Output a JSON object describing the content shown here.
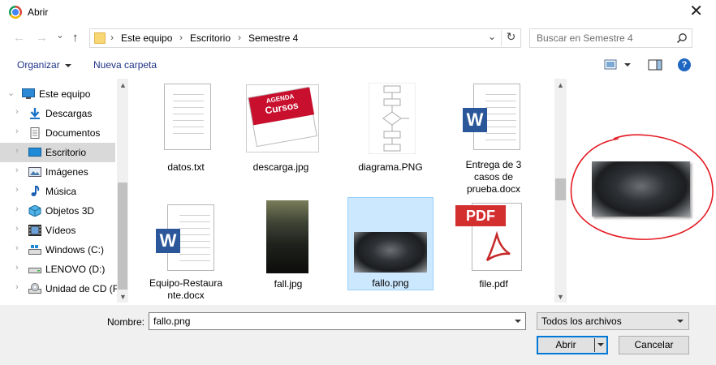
{
  "window": {
    "title": "Abrir",
    "close_glyph": "✕"
  },
  "nav": {
    "back_glyph": "←",
    "forward_glyph": "→",
    "recent_glyph": "⌄",
    "up_glyph": "↑"
  },
  "address": {
    "crumbs": [
      "Este equipo",
      "Escritorio",
      "Semestre 4"
    ],
    "separator": "›",
    "dropdown_glyph": "⌄",
    "refresh_glyph": "↻"
  },
  "search": {
    "placeholder": "Buscar en Semestre 4",
    "icon": "search-icon"
  },
  "toolbar": {
    "organize": "Organizar",
    "new_folder": "Nueva carpeta",
    "view_icon": "view-icon",
    "pane_icon": "preview-pane-icon",
    "help_glyph": "?"
  },
  "sidebar": {
    "items": [
      {
        "label": "Este equipo",
        "icon": "computer-icon",
        "chev": "⌄"
      },
      {
        "label": "Descargas",
        "icon": "download-icon",
        "chev": "›"
      },
      {
        "label": "Documentos",
        "icon": "documents-icon",
        "chev": "›"
      },
      {
        "label": "Escritorio",
        "icon": "desktop-icon",
        "chev": "›"
      },
      {
        "label": "Imágenes",
        "icon": "images-icon",
        "chev": "›"
      },
      {
        "label": "Música",
        "icon": "music-icon",
        "chev": "›"
      },
      {
        "label": "Objetos 3D",
        "icon": "objects3d-icon",
        "chev": "›"
      },
      {
        "label": "Vídeos",
        "icon": "videos-icon",
        "chev": "›"
      },
      {
        "label": "Windows (C:)",
        "icon": "drive-icon",
        "chev": "›"
      },
      {
        "label": "LENOVO (D:)",
        "icon": "drive-icon",
        "chev": "›"
      },
      {
        "label": "Unidad de CD (F",
        "icon": "cd-icon",
        "chev": "›"
      }
    ],
    "selected": "Escritorio"
  },
  "files": [
    {
      "name": "datos.txt",
      "type": "text-document"
    },
    {
      "name": "descarga.jpg",
      "type": "image-calendar",
      "calendar_top": "AGENDA",
      "calendar_main": "Cursos"
    },
    {
      "name": "diagrama.PNG",
      "type": "image-diagram"
    },
    {
      "name": "Entrega de 3 casos de prueba.docx",
      "type": "word-document",
      "badge": "W"
    },
    {
      "name": "Equipo-Restaurante.docx",
      "type": "word-document",
      "badge": "W"
    },
    {
      "name": "fall.jpg",
      "type": "image-photo"
    },
    {
      "name": "fallo.png",
      "type": "image-photo",
      "selected": true
    },
    {
      "name": "file.pdf",
      "type": "pdf-document",
      "badge": "PDF"
    }
  ],
  "file_name_lines": {
    "entrega": [
      "Entrega de 3",
      "casos de",
      "prueba.docx"
    ],
    "equipo": [
      "Equipo-Restaura",
      "nte.docx"
    ]
  },
  "scroll": {
    "up_glyph": "▲",
    "down_glyph": "▼"
  },
  "bottom": {
    "name_label": "Nombre:",
    "name_value": "fallo.png",
    "filter_value": "Todos los archivos",
    "open_button": "Abrir",
    "cancel_button": "Cancelar"
  },
  "colors": {
    "selection": "#cce8ff",
    "annotation": "#e31b23",
    "accent": "#0078d7"
  }
}
